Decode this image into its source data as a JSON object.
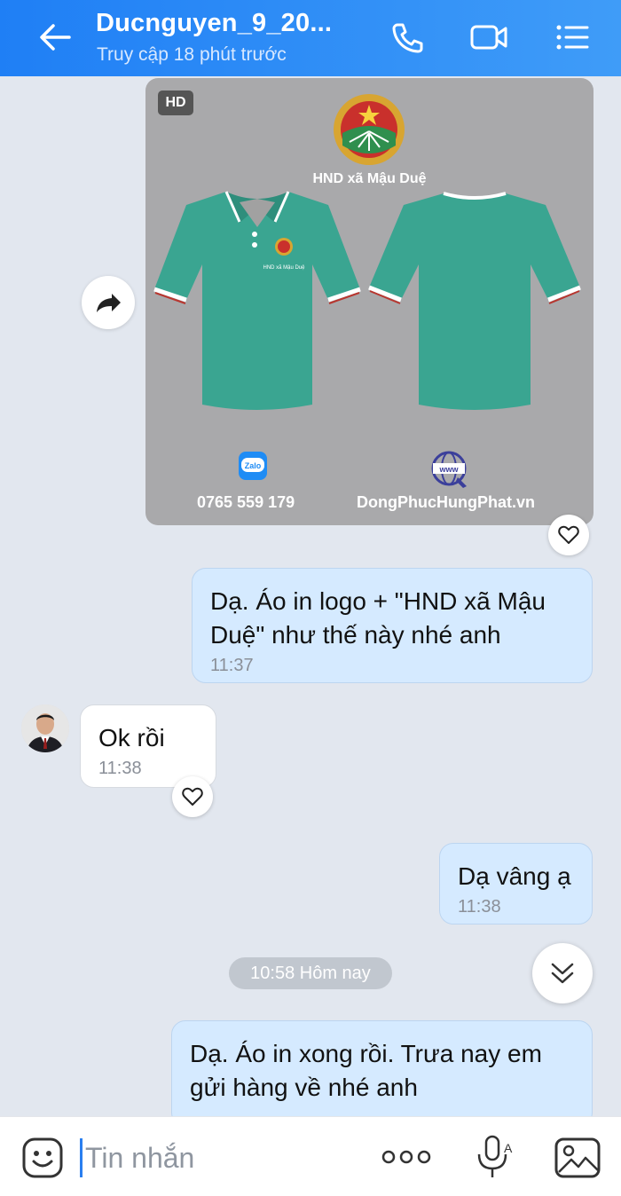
{
  "header": {
    "title": "Ducnguyen_9_20...",
    "subtitle": "Truy cập 18 phút trước",
    "icons": [
      "back-arrow-icon",
      "phone-icon",
      "video-call-icon",
      "menu-list-icon"
    ]
  },
  "image_message": {
    "badge": "HD",
    "caption": "HND xã Mậu Duệ",
    "phone": "0765 559 179",
    "website": "DongPhucHungPhat.vn",
    "zalo_label": "Zalo",
    "www_label": "www",
    "shirt_color": "#3aa591"
  },
  "messages": [
    {
      "direction": "out",
      "text_line1": "Dạ. Áo in logo + \"HND xã Mậu",
      "text_line2": "Duệ\" như thế này nhé anh",
      "time": "11:37"
    },
    {
      "direction": "in",
      "text": "Ok rồi",
      "time": "11:38"
    },
    {
      "direction": "out",
      "text": "Dạ vâng ạ",
      "time": "11:38"
    },
    {
      "direction": "out",
      "text_line1": "Dạ. Áo in xong rồi. Trưa nay em",
      "text_line2": "gửi hàng về nhé anh"
    }
  ],
  "date_separator": "10:58 Hôm nay",
  "composer": {
    "placeholder": "Tin nhắn",
    "icons": [
      "emoji-icon",
      "more-dots-icon",
      "voice-mic-icon",
      "gallery-icon"
    ]
  },
  "colors": {
    "header_start": "#1f7ff5",
    "header_end": "#3f9cf8",
    "chat_bg": "#e2e7ef",
    "outgoing_bubble": "#d5eaff",
    "incoming_bubble": "#ffffff"
  }
}
